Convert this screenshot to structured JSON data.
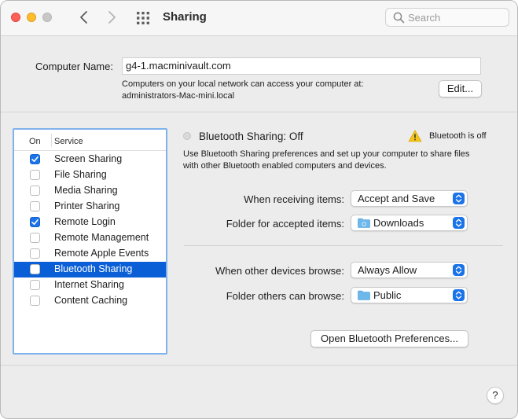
{
  "window": {
    "title": "Sharing"
  },
  "search": {
    "placeholder": "Search"
  },
  "computer_name": {
    "label": "Computer Name:",
    "value": "g4-1.macminivault.com",
    "desc_line1": "Computers on your local network can access your computer at:",
    "desc_line2": "administrators-Mac-mini.local",
    "edit_label": "Edit..."
  },
  "services": {
    "header_on": "On",
    "header_service": "Service",
    "items": [
      {
        "label": "Screen Sharing",
        "checked": true
      },
      {
        "label": "File Sharing",
        "checked": false
      },
      {
        "label": "Media Sharing",
        "checked": false
      },
      {
        "label": "Printer Sharing",
        "checked": false
      },
      {
        "label": "Remote Login",
        "checked": true
      },
      {
        "label": "Remote Management",
        "checked": false
      },
      {
        "label": "Remote Apple Events",
        "checked": false
      },
      {
        "label": "Bluetooth Sharing",
        "checked": false,
        "selected": true
      },
      {
        "label": "Internet Sharing",
        "checked": false
      },
      {
        "label": "Content Caching",
        "checked": false
      }
    ]
  },
  "detail": {
    "status": "Bluetooth Sharing: Off",
    "warning": "Bluetooth is off",
    "description_line1": "Use Bluetooth Sharing preferences and set up your computer to share files",
    "description_line2": "with other Bluetooth enabled computers and devices.",
    "receiving_label": "When receiving items:",
    "receiving_value": "Accept and Save",
    "folder_accepted_label": "Folder for accepted items:",
    "folder_accepted_value": "Downloads",
    "browse_label": "When other devices browse:",
    "browse_value": "Always Allow",
    "folder_browse_label": "Folder others can browse:",
    "folder_browse_value": "Public",
    "open_prefs_label": "Open Bluetooth Preferences..."
  },
  "help": {
    "label": "?"
  },
  "colors": {
    "accent": "#1a73e8",
    "selection": "#0a5fd6",
    "focus_ring": "#7fb2ec"
  }
}
